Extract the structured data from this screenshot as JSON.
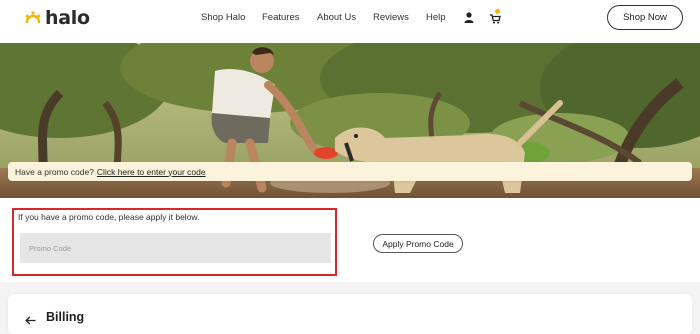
{
  "header": {
    "logo_text": "halo",
    "nav": [
      "Shop Halo",
      "Features",
      "About Us",
      "Reviews",
      "Help"
    ],
    "account_icon": "user-icon",
    "cart_icon": "cart-icon",
    "shop_now_label": "Shop Now",
    "accent_color": "#f2b705"
  },
  "hero": {
    "image_icon": "hero-photo"
  },
  "promo_banner": {
    "prefix": "Have a promo code?",
    "link": "Click here to enter your code"
  },
  "promo": {
    "instruction": "If you have a promo code, please apply it below.",
    "input_placeholder": "Promo Code",
    "input_value": "",
    "apply_label": "Apply Promo Code",
    "highlight_color": "#d9262c"
  },
  "billing": {
    "back_icon": "arrow-left-icon",
    "title": "Billing"
  }
}
